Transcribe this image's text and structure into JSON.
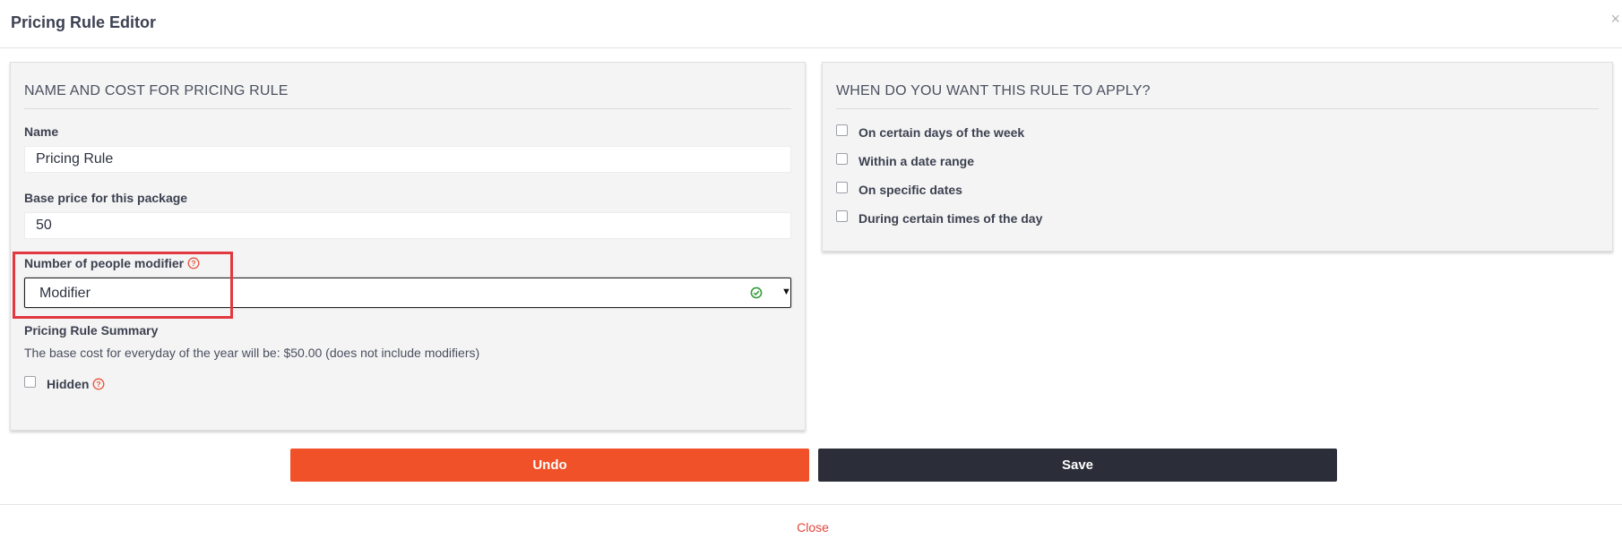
{
  "modal": {
    "title": "Pricing Rule Editor",
    "close_glyph": "×"
  },
  "left_panel": {
    "title": "NAME AND COST FOR PRICING RULE",
    "name_label": "Name",
    "name_value": "Pricing Rule",
    "base_price_label": "Base price for this package",
    "base_price_value": "50",
    "modifier_label": "Number of people modifier",
    "modifier_selected": "Modifier",
    "summary_label": "Pricing Rule Summary",
    "summary_text": "The base cost for everyday of the year will be: $50.00 (does not include modifiers)",
    "hidden_label": "Hidden",
    "hidden_checked": false
  },
  "right_panel": {
    "title": "WHEN DO YOU WANT THIS RULE TO APPLY?",
    "options": [
      {
        "label": "On certain days of the week",
        "checked": false
      },
      {
        "label": "Within a date range",
        "checked": false
      },
      {
        "label": "On specific dates",
        "checked": false
      },
      {
        "label": "During certain times of the day",
        "checked": false
      }
    ]
  },
  "actions": {
    "undo_label": "Undo",
    "save_label": "Save"
  },
  "footer": {
    "close_label": "Close"
  },
  "icons": {
    "help": "question-circle-icon",
    "valid": "check-circle-icon",
    "caret": "caret-down-icon"
  },
  "colors": {
    "accent_orange": "#f05128",
    "dark_button": "#2b2e38",
    "highlight_red": "#e2383f",
    "valid_green": "#3a9d3e",
    "help_orange": "#e8533c",
    "panel_bg": "#f4f4f4"
  }
}
